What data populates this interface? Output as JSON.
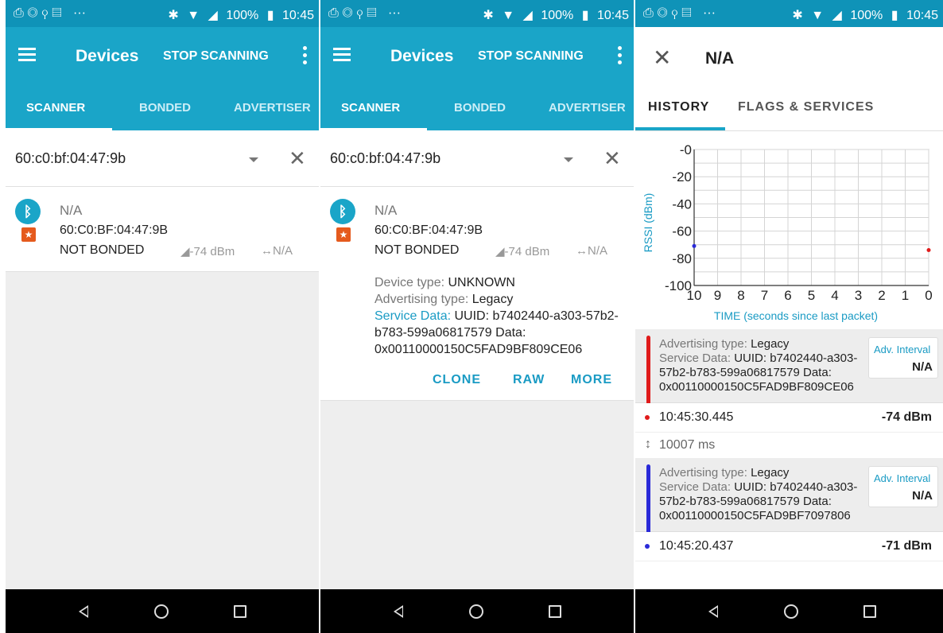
{
  "status_bar": {
    "battery": "100%",
    "time": "10:45"
  },
  "appbar": {
    "title": "Devices",
    "stop_label": "STOP SCANNING"
  },
  "tabs": [
    "SCANNER",
    "BONDED",
    "ADVERTISER"
  ],
  "filter": {
    "value": "60:c0:bf:04:47:9b"
  },
  "device": {
    "name": "N/A",
    "address": "60:C0:BF:04:47:9B",
    "bond_state": "NOT BONDED",
    "rssi": "-74 dBm",
    "interval": "N/A"
  },
  "device_details": {
    "device_type_key": "Device type: ",
    "device_type_val": "UNKNOWN",
    "adv_type_key": "Advertising type: ",
    "adv_type_val": "Legacy",
    "service_key": "Service Data: ",
    "service_val": "UUID: b7402440-a303-57b2-b783-599a06817579 Data: 0x00110000150C5FAD9BF809CE06"
  },
  "actions": [
    "CLONE",
    "RAW",
    "MORE"
  ],
  "detail_screen": {
    "title": "N/A",
    "tabs": [
      "HISTORY",
      "FLAGS & SERVICES"
    ]
  },
  "chart_data": {
    "type": "scatter",
    "xlabel": "TIME (seconds since last packet)",
    "ylabel": "RSSI (dBm)",
    "x_ticks": [
      "10",
      "9",
      "8",
      "7",
      "6",
      "5",
      "4",
      "3",
      "2",
      "1",
      "0"
    ],
    "y_ticks": [
      "-0",
      "-20",
      "-40",
      "-60",
      "-80",
      "-100"
    ],
    "xlim": [
      10,
      0
    ],
    "ylim": [
      -100,
      0
    ],
    "grid": true,
    "series": [
      {
        "color": "#e01b1b",
        "points": [
          {
            "x": 0,
            "y": -74
          }
        ]
      },
      {
        "color": "#2a2ad8",
        "points": [
          {
            "x": 10,
            "y": -71
          }
        ]
      }
    ]
  },
  "history": {
    "entries": [
      {
        "color": "#e01b1b",
        "adv_type_key": "Advertising type: ",
        "adv_type_val": "Legacy",
        "service_key": "Service Data: ",
        "service_val": "UUID: b7402440-a303-57b2-b783-599a06817579 Data: 0x00110000150C5FAD9BF809CE06",
        "interval_label": "Adv. Interval",
        "interval_val": "N/A",
        "time": "10:45:30.445",
        "rssi": "-74 dBm"
      },
      {
        "color": "#2a2ad8",
        "adv_type_key": "Advertising type: ",
        "adv_type_val": "Legacy",
        "service_key": "Service Data: ",
        "service_val": "UUID: b7402440-a303-57b2-b783-599a06817579 Data: 0x00110000150C5FAD9BF7097806",
        "interval_label": "Adv. Interval",
        "interval_val": "N/A",
        "time": "10:45:20.437",
        "rssi": "-71 dBm"
      }
    ],
    "gap": "10007 ms"
  },
  "icons": {
    "bluetooth": "bluetooth-icon",
    "favorite": "star-icon",
    "signal": "signal-icon",
    "interval": "interval-arrows-icon"
  }
}
